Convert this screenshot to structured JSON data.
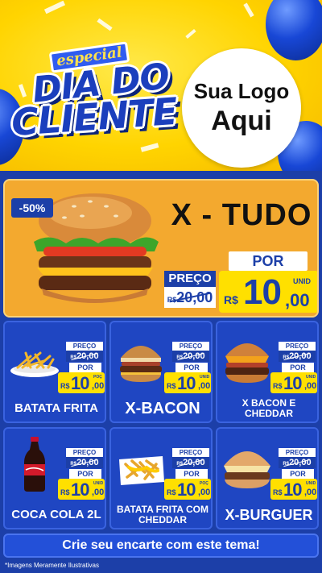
{
  "header": {
    "tag": "especial",
    "title_line1": "DIA DO",
    "title_line2": "CLIENTE",
    "logo_line1": "Sua Logo",
    "logo_line2": "Aqui"
  },
  "featured": {
    "discount": "-50%",
    "name": "X - TUDO",
    "preco_label": "PREÇO",
    "old_currency": "R$",
    "old_price": "20,00",
    "por_label": "POR",
    "currency": "R$",
    "price_int": "10",
    "price_dec": ",00",
    "unit": "UNID"
  },
  "products": [
    {
      "name": "BATATA FRITA",
      "preco_label": "PREÇO",
      "old_currency": "R$",
      "old_price": "20,00",
      "por_label": "POR",
      "currency": "R$",
      "price_int": "10",
      "price_dec": ",00",
      "unit": "POÇ"
    },
    {
      "name": "X-BACON",
      "preco_label": "PREÇO",
      "old_currency": "R$",
      "old_price": "20,00",
      "por_label": "POR",
      "currency": "R$",
      "price_int": "10",
      "price_dec": ",00",
      "unit": "UNID"
    },
    {
      "name": "X BACON E CHEDDAR",
      "preco_label": "PREÇO",
      "old_currency": "R$",
      "old_price": "20,00",
      "por_label": "POR",
      "currency": "R$",
      "price_int": "10",
      "price_dec": ",00",
      "unit": "UNID"
    },
    {
      "name": "COCA COLA 2L",
      "preco_label": "PREÇO",
      "old_currency": "R$",
      "old_price": "20,00",
      "por_label": "POR",
      "currency": "R$",
      "price_int": "10",
      "price_dec": ",00",
      "unit": "UNID"
    },
    {
      "name": "BATATA FRITA COM CHEDDAR",
      "preco_label": "PREÇO",
      "old_currency": "R$",
      "old_price": "20,00",
      "por_label": "POR",
      "currency": "R$",
      "price_int": "10",
      "price_dec": ",00",
      "unit": "POÇ"
    },
    {
      "name": "X-BURGUER",
      "preco_label": "PREÇO",
      "old_currency": "R$",
      "old_price": "20,00",
      "por_label": "POR",
      "currency": "R$",
      "price_int": "10",
      "price_dec": ",00",
      "unit": "UNID"
    }
  ],
  "footer": {
    "cta": "Crie seu encarte com este tema!",
    "disclaimer": "*Imagens Meramente Ilustrativas"
  },
  "colors": {
    "background_blue": "#1c3fa8",
    "header_yellow": "#ffd400",
    "featured_orange": "#f3a92f",
    "price_yellow": "#ffe000",
    "card_blue": "#1f46c2"
  },
  "icons": [
    "balloon-icon",
    "burger-icon",
    "fries-icon",
    "soda-bottle-icon",
    "cheese-fries-icon"
  ]
}
